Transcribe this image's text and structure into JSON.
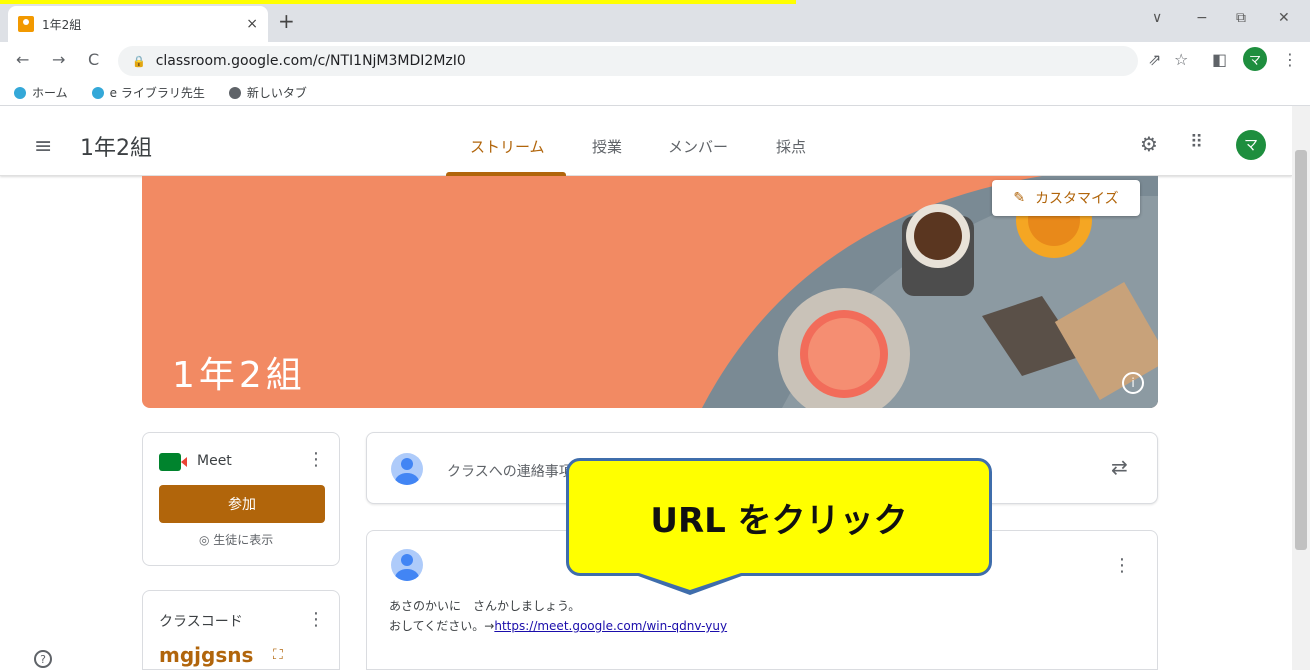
{
  "browser": {
    "tab_title": "1年2組",
    "tab_close": "×",
    "new_tab": "+",
    "url": "classroom.google.com/c/NTI1NjM3MDI2MzI0",
    "profile_initial": "マ",
    "window_controls": {
      "collapse": "∨",
      "minimize": "−",
      "restore": "⧉",
      "close": "✕"
    },
    "nav": {
      "back": "←",
      "forward": "→",
      "reload": "C"
    },
    "right_icons": {
      "share": "⇗",
      "star": "☆",
      "sidepanel": "◧",
      "menu": "⋮"
    }
  },
  "bookmarks": [
    {
      "label": "ホーム",
      "icon": "education-icon"
    },
    {
      "label": "e ライブラリ先生",
      "icon": "education-icon"
    },
    {
      "label": "新しいタブ",
      "icon": "globe-icon"
    }
  ],
  "app": {
    "menu_icon": "≡",
    "class_title": "1年2組",
    "tabs": [
      {
        "label": "ストリーム",
        "active": true
      },
      {
        "label": "授業",
        "active": false
      },
      {
        "label": "メンバー",
        "active": false
      },
      {
        "label": "採点",
        "active": false
      }
    ],
    "settings_icon": "⚙",
    "apps_icon": "⠿",
    "avatar_initial": "マ"
  },
  "banner": {
    "title": "1年2組",
    "customize_label": "カスタマイズ",
    "customize_icon": "✎",
    "info_icon": "i",
    "color": "#f28a63"
  },
  "meet": {
    "label": "Meet",
    "join_label": "参加",
    "visible_label": "◎ 生徒に表示",
    "menu": "⋮"
  },
  "class_code": {
    "label": "クラスコード",
    "value": "mgjgsns",
    "expand_icon": "⛶",
    "menu": "⋮"
  },
  "announce": {
    "placeholder": "クラスへの連絡事項",
    "repost_icon": "⇄"
  },
  "post": {
    "line1": "あさのかいに　さんかしましょう。",
    "line2_prefix": "おしてください。→",
    "link": "https://meet.google.com/win-qdnv-yuy",
    "menu": "⋮"
  },
  "callout": {
    "text": "URL をクリック",
    "color": "#ffff00"
  },
  "help_icon": "?",
  "accent_color": "#b1650b"
}
